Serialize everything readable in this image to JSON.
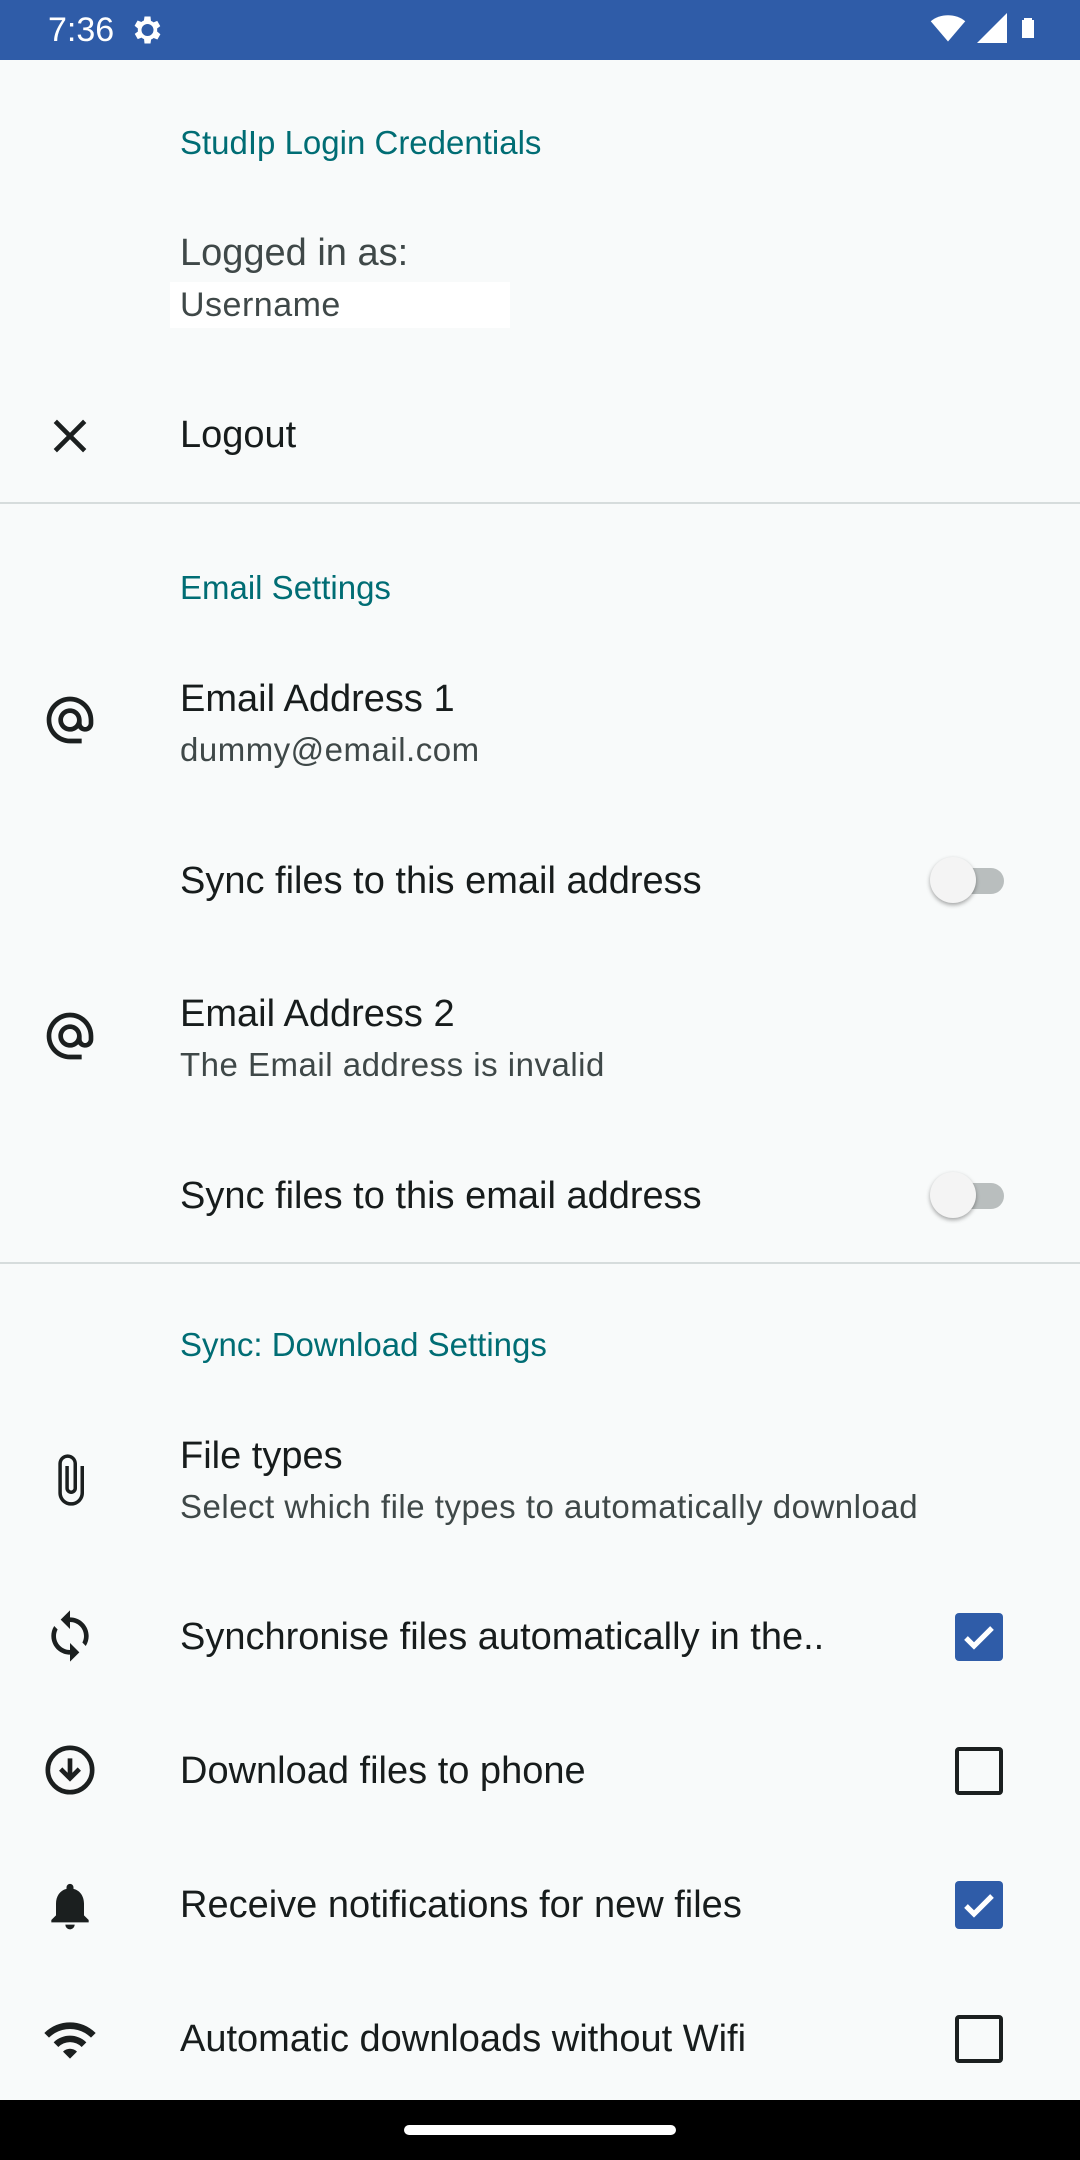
{
  "status_bar": {
    "time": "7:36",
    "icons": [
      "settings-gear-icon",
      "wifi-icon",
      "cellular-signal-icon",
      "battery-icon"
    ],
    "color": "#2f5ca8"
  },
  "login_section": {
    "header": "StudIp Login Credentials",
    "logged_in_label": "Logged in as:",
    "username": "Username",
    "logout_label": "Logout",
    "logout_icon": "close-icon"
  },
  "email_section": {
    "header": "Email Settings",
    "emails": [
      {
        "title": "Email Address 1",
        "summary": "dummy@email.com",
        "icon": "at-sign-icon",
        "sync_label": "Sync files to this email address",
        "sync_enabled": false
      },
      {
        "title": "Email Address 2",
        "summary": "The Email address is invalid",
        "icon": "at-sign-icon",
        "sync_label": "Sync files to this email address",
        "sync_enabled": false
      }
    ]
  },
  "download_section": {
    "header": "Sync: Download Settings",
    "file_types": {
      "title": "File types",
      "summary": "Select which file types to automatically download",
      "icon": "paperclip-icon"
    },
    "options": [
      {
        "label": "Synchronise files automatically in the..",
        "checked": true,
        "icon": "sync-icon"
      },
      {
        "label": "Download files to phone",
        "checked": false,
        "icon": "download-circle-icon"
      },
      {
        "label": "Receive notifications for new files",
        "checked": true,
        "icon": "bell-icon"
      },
      {
        "label": "Automatic downloads without Wifi",
        "checked": false,
        "icon": "wifi-icon"
      }
    ]
  },
  "colors": {
    "accent": "#006d74",
    "checkbox": "#2f5ca8",
    "background": "#f8fafa"
  }
}
